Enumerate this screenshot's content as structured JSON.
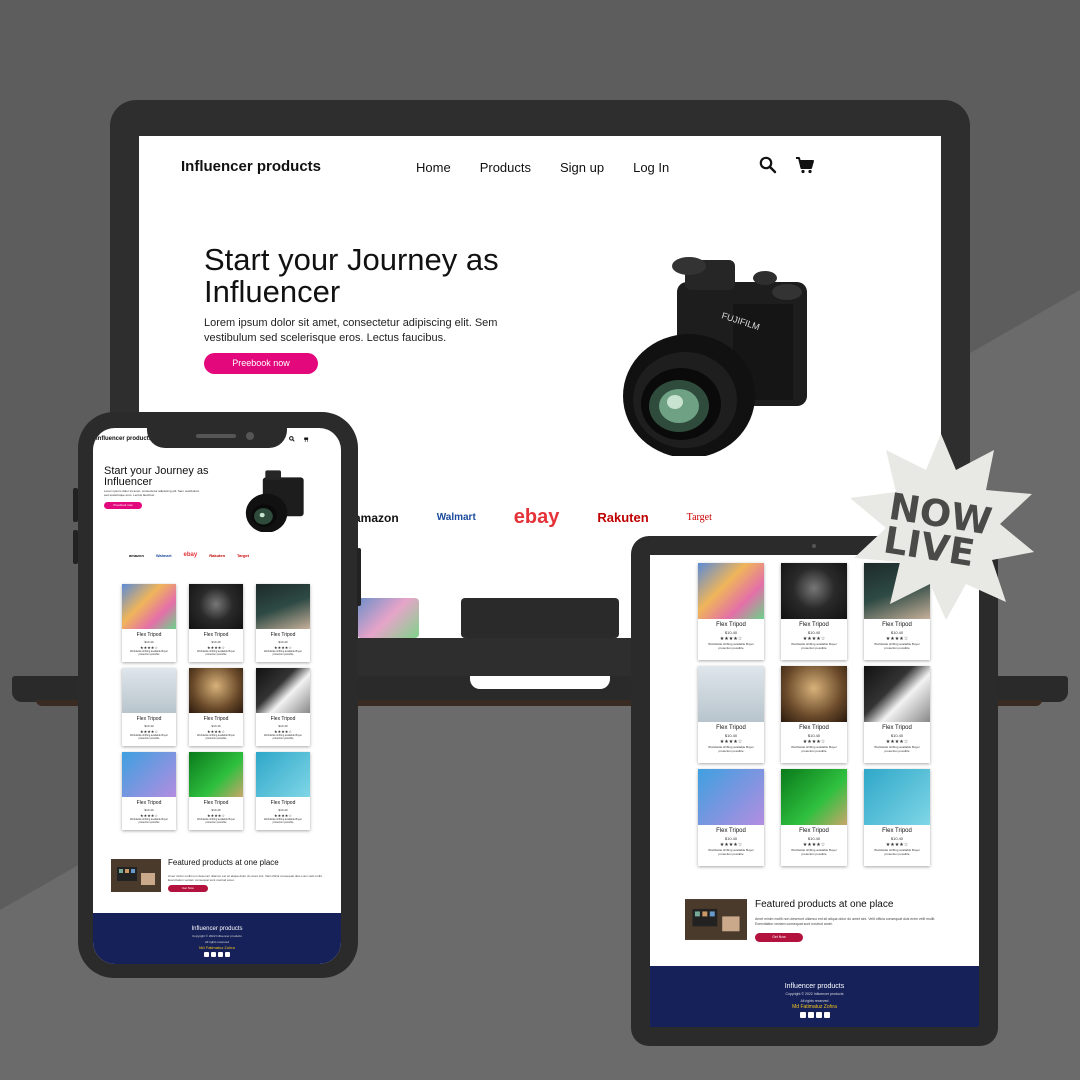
{
  "site": {
    "brand": "Influencer products",
    "nav": [
      "Home",
      "Products",
      "Sign up",
      "Log In"
    ],
    "hero_title": "Start your Journey as Influencer",
    "hero_text": "Lorem ipsum dolor sit amet, consectetur adipiscing elit. Sem vestibulum sed scelerisque eros. Lectus faucibus.",
    "hero_button": "Preebook now",
    "brands": [
      "amazon",
      "Walmart",
      "ebay",
      "Rakuten",
      "Target"
    ]
  },
  "product": {
    "name": "Flex Tripod",
    "price": "$10.40",
    "rating": "★★★★☆",
    "desc": "Worldwide shifting available Buyer protection possible"
  },
  "featured": {
    "title": "Featured products at one place",
    "text": "Amet minim mollit non deserunt ullamco est sit aliqua dolor do amet sint. Velit officia consequat duis enim velit mollit. Exercitation veniam consequat sunt nostrud amet.",
    "button": "Get Now"
  },
  "footer": {
    "title": "Influencer products",
    "copyright": "Copyright © 2022 Influencer products",
    "rights": "All rights reserved",
    "author": "Md Fatimatuz Zohra"
  },
  "badge": {
    "line1": "NOW",
    "line2": "LIVE"
  },
  "colors": {
    "accent": "#e3097c",
    "button_dark": "#b3123e",
    "footer_bg": "#16215a",
    "author": "#f5c518"
  },
  "product_images": [
    "tripod-colorful",
    "microphone-dark",
    "hand-card",
    "drone-white",
    "studio-lights",
    "softbox-studio",
    "camera-blue",
    "green-screen",
    "action-camera-water"
  ]
}
